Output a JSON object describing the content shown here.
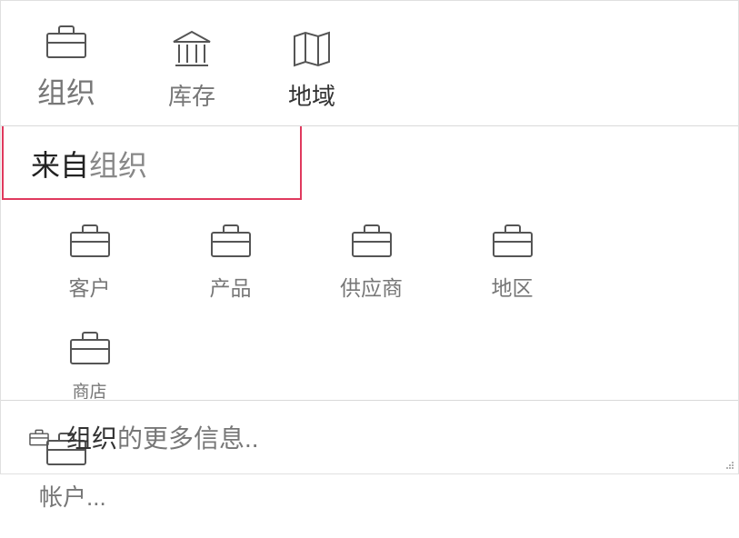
{
  "topnav": {
    "items": [
      {
        "label": "组织",
        "icon": "briefcase"
      },
      {
        "label": "库存",
        "icon": "bank"
      },
      {
        "label": "地域",
        "icon": "map"
      }
    ]
  },
  "section": {
    "prefix": "来自",
    "title": "组织"
  },
  "grid": {
    "items": [
      {
        "label": "客户",
        "icon": "briefcase"
      },
      {
        "label": "产品",
        "icon": "briefcase"
      },
      {
        "label": "供应商",
        "icon": "briefcase"
      },
      {
        "label": "地区",
        "icon": "briefcase"
      },
      {
        "label": "商店",
        "icon": "briefcase"
      },
      {
        "label": "帐户...",
        "icon": "briefcase"
      }
    ]
  },
  "footer": {
    "prefix": "组织",
    "suffix": "的更多信息.."
  }
}
